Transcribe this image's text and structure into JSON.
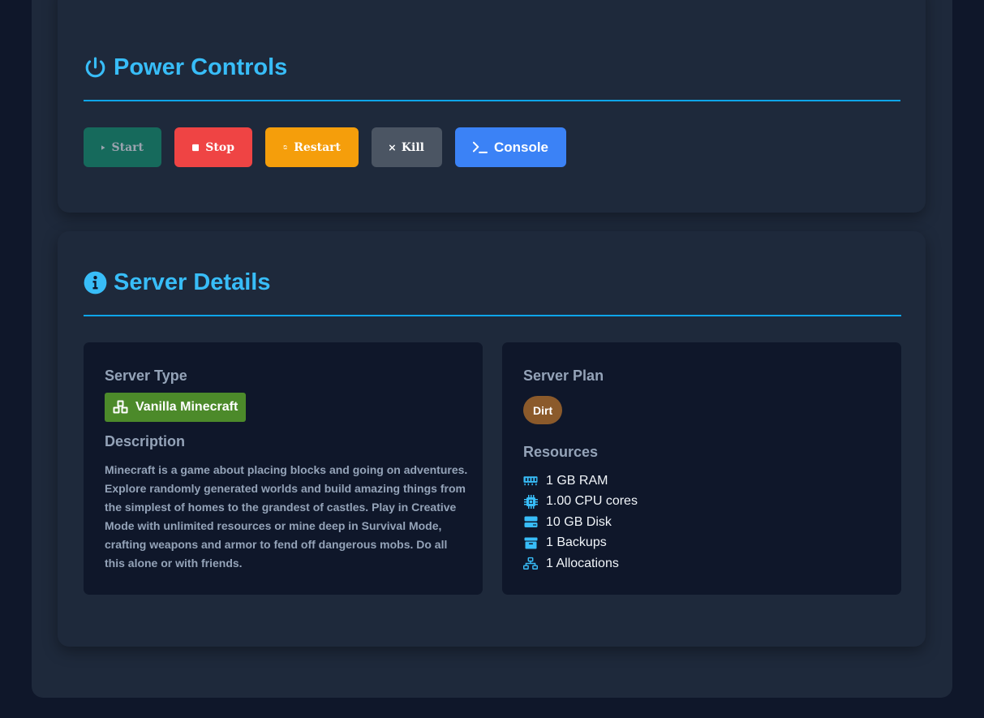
{
  "power": {
    "title": "Power Controls",
    "buttons": {
      "start": "Start",
      "stop": "Stop",
      "restart": "Restart",
      "kill": "Kill",
      "console": "Console"
    }
  },
  "details": {
    "title": "Server Details",
    "server_type_label": "Server Type",
    "server_type": "Vanilla Minecraft",
    "description_label": "Description",
    "description": "Minecraft is a game about placing blocks and going on adventures. Explore randomly generated worlds and build amazing things from the simplest of homes to the grandest of castles. Play in Creative Mode with unlimited resources or mine deep in Survival Mode, crafting weapons and armor to fend off dangerous mobs. Do all this alone or with friends.",
    "server_plan_label": "Server Plan",
    "server_plan": "Dirt",
    "resources_label": "Resources",
    "resources": [
      {
        "icon": "memory-icon",
        "text": "1 GB RAM"
      },
      {
        "icon": "cpu-icon",
        "text": "1.00 CPU cores"
      },
      {
        "icon": "disk-icon",
        "text": "10 GB Disk"
      },
      {
        "icon": "archive-icon",
        "text": "1 Backups"
      },
      {
        "icon": "network-icon",
        "text": "1 Allocations"
      }
    ]
  },
  "colors": {
    "accent": "#38bdf8",
    "start": "#166a5c",
    "stop": "#ef4444",
    "restart": "#f59e0b",
    "kill": "#4b5563",
    "console": "#3b82f6",
    "type_badge": "#4c8a2a",
    "plan_badge": "#8b5a2b"
  }
}
